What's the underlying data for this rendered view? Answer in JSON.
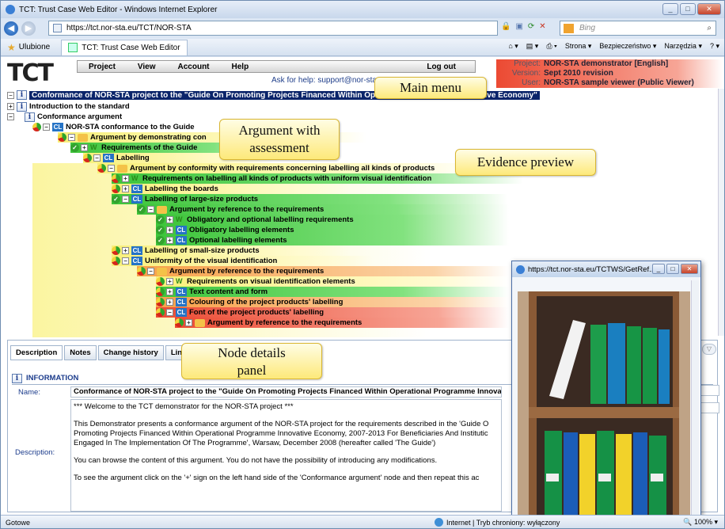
{
  "browser": {
    "window_title": "TCT: Trust Case Web Editor - Windows Internet Explorer",
    "url": "https://tct.nor-sta.eu/TCT/NOR-STA",
    "search_placeholder": "Bing",
    "favorites_label": "Ulubione",
    "tab_title": "TCT: Trust Case Web Editor",
    "command_bar": [
      "Strona ▾",
      "Bezpieczeństwo ▾",
      "Narzędzia ▾"
    ],
    "status_left": "Gotowe",
    "status_zone": "Internet | Tryb chroniony: wyłączony",
    "zoom": "100%"
  },
  "app": {
    "logo_text": "TCT",
    "menu": [
      "Project",
      "View",
      "Account",
      "Help"
    ],
    "logout": "Log out",
    "help_text": "Ask for help: support@nor-sta.",
    "project": {
      "project_label": "Project:",
      "project_value": "NOR-STA demonstrator [English]",
      "version_label": "Version:",
      "version_value": "Sept 2010 revision",
      "user_label": "User:",
      "user_value": "NOR-STA sample viewer (Public Viewer)"
    }
  },
  "tree": {
    "root": "Conformance of NOR-STA project to the \"Guide On Promoting Projects Financed Within Operational Programme Innovative Economy\"",
    "nodes": [
      "Introduction to the standard",
      "Conformance argument",
      "NOR-STA conformance to the Guide",
      "Argument by demonstrating con",
      "uide",
      "Requirements of the Guide",
      "Labelling",
      "Argument by conformity with requirements concerning labelling all kinds of products",
      "Requirements on labelling all kinds of products with uniform visual identification",
      "Labelling the boards",
      "Labelling of large-size products",
      "Argument by reference to the requirements",
      "Obligatory and optional labelling requirements",
      "Obligatory labelling elements",
      "Optional labelling elements",
      "Labelling of small-size products",
      "Uniformity of the visual identification",
      "Argument by reference to the requirements",
      "Requirements on visual identification elements",
      "Text content and form",
      "Colouring of the project products' labelling",
      "Font of the project products' labelling",
      "Argument by reference to the requirements"
    ]
  },
  "callouts": {
    "main_menu": "Main menu",
    "argument_1": "Argument with",
    "argument_2": "assessment",
    "evidence": "Evidence preview",
    "details_1": "Node details",
    "details_2": "panel"
  },
  "details": {
    "tabs": [
      "Description",
      "Notes",
      "Change history",
      "Links"
    ],
    "section_title": "INFORMATION",
    "name_label": "Name:",
    "name_value": "Conformance of NOR-STA project to the \"Guide On Promoting Projects Financed Within Operational Programme Innovative E",
    "description_label": "Description:",
    "description": [
      "*** Welcome to the TCT demonstrator for the NOR-STA project ***",
      "This Demonstrator presents a conformance argument of the NOR-STA project for the requirements described in the 'Guide O Promoting Projects Financed Within Operational Programme Innovative Economy, 2007-2013 For Beneficiaries And Institutic Engaged In The Implementation Of The Programme', Warsaw, December 2008 (hereafter called 'The Guide')",
      "You can  browse the content of this argument. You do not have the possibility of introducing any modifications.",
      "To see the argument click on the '+' sign on the left hand side of the 'Conformance argument' node and then repeat this ac"
    ]
  },
  "popup": {
    "title": "https://tct.nor-sta.eu/TCTWS/GetRef..."
  },
  "colors": {
    "accent": "#0a246a",
    "green": "#3dc43a",
    "yellow": "#f9f07a",
    "orange": "#f7a048",
    "red": "#ec4a33",
    "callout": "#fde97a"
  }
}
